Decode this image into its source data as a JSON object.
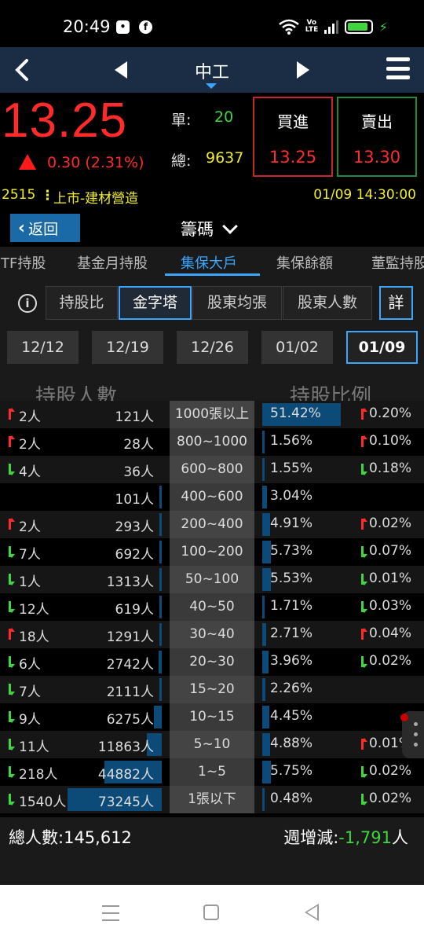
{
  "status_bar": {
    "time": "20:49",
    "volte": "Vo LTE",
    "battery_level": 0.9
  },
  "header": {
    "stock_name": "中工"
  },
  "quote": {
    "price": "13.25",
    "change": "0.30 (2.31%)",
    "single_label": "單:",
    "single_value": "20",
    "total_label": "總:",
    "total_value": "9637",
    "buy_label": "買進",
    "buy_price": "13.25",
    "sell_label": "賣出",
    "sell_price": "13.30"
  },
  "info": {
    "code": "2515",
    "market": "上市-建材營造",
    "datetime": "01/09 14:30:00"
  },
  "actions": {
    "back_label": "返回",
    "view_label": "籌碼"
  },
  "tabs": [
    {
      "label": "TF持股"
    },
    {
      "label": "基金月持股"
    },
    {
      "label": "集保大戶"
    },
    {
      "label": "集保餘額"
    },
    {
      "label": "董監持股"
    }
  ],
  "subtabs": {
    "info_glyph": "i",
    "items": [
      {
        "label": "持股比"
      },
      {
        "label": "金字塔"
      },
      {
        "label": "股東均張"
      },
      {
        "label": "股東人數"
      }
    ],
    "detail_label": "詳"
  },
  "dates": [
    "12/12",
    "12/19",
    "12/26",
    "01/02",
    "01/09"
  ],
  "headers": {
    "holders": "持股人數",
    "ratio": "持股比例"
  },
  "rows": [
    {
      "change_people": "2人",
      "change_dir": "up",
      "holders": "121人",
      "holders_frac": 0,
      "range": "1000張以上",
      "ratio": "51.42%",
      "ratio_frac": 1.0,
      "ratio_change": "0.20%",
      "ratio_dir": "up"
    },
    {
      "change_people": "2人",
      "change_dir": "up",
      "holders": "28人",
      "holders_frac": 0,
      "range": "800~1000",
      "ratio": "1.56%",
      "ratio_frac": 0.03,
      "ratio_change": "0.10%",
      "ratio_dir": "up"
    },
    {
      "change_people": "4人",
      "change_dir": "down",
      "holders": "36人",
      "holders_frac": 0,
      "range": "600~800",
      "ratio": "1.55%",
      "ratio_frac": 0.03,
      "ratio_change": "0.18%",
      "ratio_dir": "down"
    },
    {
      "change_people": "",
      "change_dir": "",
      "holders": "101人",
      "holders_frac": 0.001,
      "range": "400~600",
      "ratio": "3.04%",
      "ratio_frac": 0.06,
      "ratio_change": "",
      "ratio_dir": ""
    },
    {
      "change_people": "2人",
      "change_dir": "up",
      "holders": "293人",
      "holders_frac": 0.004,
      "range": "200~400",
      "ratio": "4.91%",
      "ratio_frac": 0.095,
      "ratio_change": "0.02%",
      "ratio_dir": "up"
    },
    {
      "change_people": "7人",
      "change_dir": "down",
      "holders": "692人",
      "holders_frac": 0.009,
      "range": "100~200",
      "ratio": "5.73%",
      "ratio_frac": 0.11,
      "ratio_change": "0.07%",
      "ratio_dir": "down"
    },
    {
      "change_people": "1人",
      "change_dir": "down",
      "holders": "1313人",
      "holders_frac": 0.018,
      "range": "50~100",
      "ratio": "5.53%",
      "ratio_frac": 0.107,
      "ratio_change": "0.01%",
      "ratio_dir": "down"
    },
    {
      "change_people": "12人",
      "change_dir": "down",
      "holders": "619人",
      "holders_frac": 0.008,
      "range": "40~50",
      "ratio": "1.71%",
      "ratio_frac": 0.033,
      "ratio_change": "0.03%",
      "ratio_dir": "down"
    },
    {
      "change_people": "18人",
      "change_dir": "up",
      "holders": "1291人",
      "holders_frac": 0.018,
      "range": "30~40",
      "ratio": "2.71%",
      "ratio_frac": 0.053,
      "ratio_change": "0.04%",
      "ratio_dir": "up"
    },
    {
      "change_people": "6人",
      "change_dir": "down",
      "holders": "2742人",
      "holders_frac": 0.037,
      "range": "20~30",
      "ratio": "3.96%",
      "ratio_frac": 0.077,
      "ratio_change": "0.02%",
      "ratio_dir": "down"
    },
    {
      "change_people": "7人",
      "change_dir": "down",
      "holders": "2111人",
      "holders_frac": 0.029,
      "range": "15~20",
      "ratio": "2.26%",
      "ratio_frac": 0.044,
      "ratio_change": "",
      "ratio_dir": ""
    },
    {
      "change_people": "9人",
      "change_dir": "down",
      "holders": "6275人",
      "holders_frac": 0.086,
      "range": "10~15",
      "ratio": "4.45%",
      "ratio_frac": 0.087,
      "ratio_change": "",
      "ratio_dir": ""
    },
    {
      "change_people": "11人",
      "change_dir": "down",
      "holders": "11863人",
      "holders_frac": 0.162,
      "range": "5~10",
      "ratio": "4.88%",
      "ratio_frac": 0.095,
      "ratio_change": "0.01%",
      "ratio_dir": "up"
    },
    {
      "change_people": "218人",
      "change_dir": "down",
      "holders": "44882人",
      "holders_frac": 0.612,
      "range": "1~5",
      "ratio": "5.75%",
      "ratio_frac": 0.112,
      "ratio_change": "0.02%",
      "ratio_dir": "down"
    },
    {
      "change_people": "1540人",
      "change_dir": "down",
      "holders": "73245人",
      "holders_frac": 1.0,
      "range": "1張以下",
      "ratio": "0.48%",
      "ratio_frac": 0.009,
      "ratio_change": "0.02%",
      "ratio_dir": "down"
    }
  ],
  "summary": {
    "total_label": "總人數:",
    "total_value": "145,612",
    "weekly_label": "週增減:",
    "weekly_value": "-1,791",
    "weekly_unit": "人"
  },
  "colors": {
    "up": "#ff2a2a",
    "down": "#3fd63f",
    "accent": "#3aa6ff",
    "bar": "#0c4b78"
  }
}
